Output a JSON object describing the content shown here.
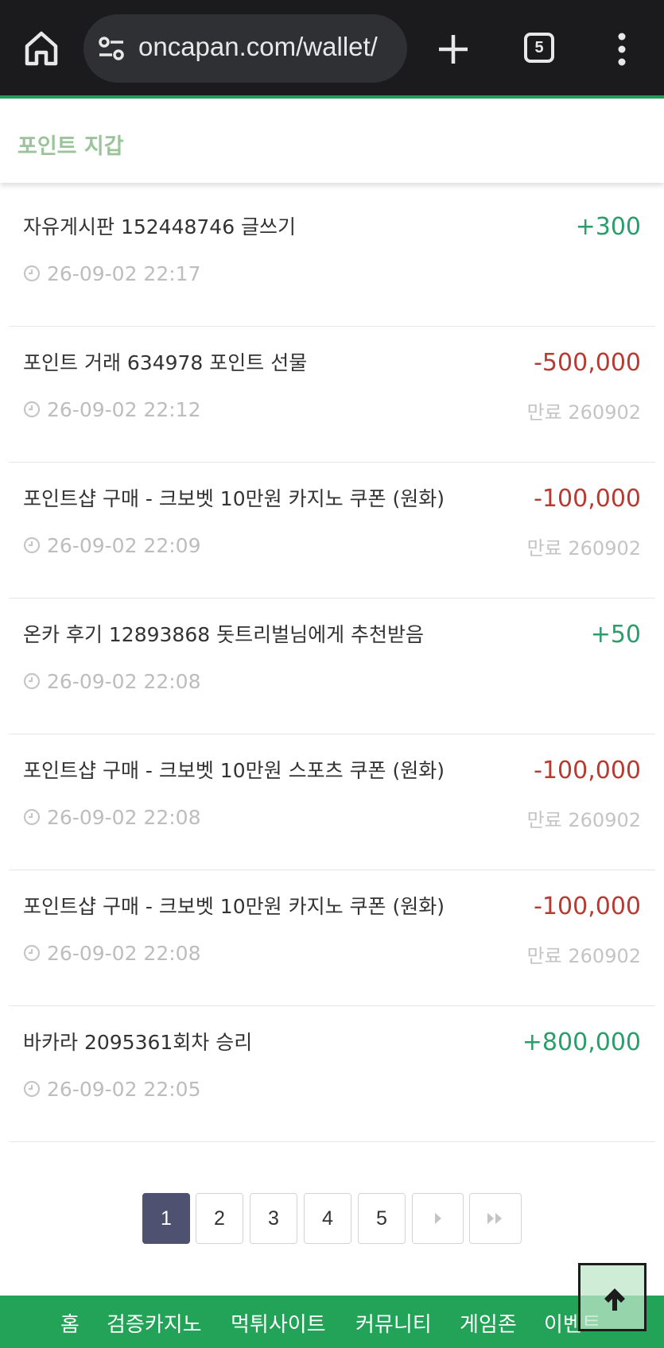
{
  "browser": {
    "url": "oncapan.com/wallet/",
    "tab_count": "5"
  },
  "header": {
    "title": "포인트 지갑"
  },
  "transactions": [
    {
      "desc": "자유게시판 152448746 글쓰기",
      "time": "26-09-02 22:17",
      "amount": "+300",
      "expire": ""
    },
    {
      "desc": "포인트 거래 634978 포인트 선물",
      "time": "26-09-02 22:12",
      "amount": "-500,000",
      "expire": "만료 260902"
    },
    {
      "desc": "포인트샵 구매 - 크보벳 10만원 카지노 쿠폰 (원화)",
      "time": "26-09-02 22:09",
      "amount": "-100,000",
      "expire": "만료 260902"
    },
    {
      "desc": "온카 후기 12893868 돗트리벌님에게 추천받음",
      "time": "26-09-02 22:08",
      "amount": "+50",
      "expire": ""
    },
    {
      "desc": "포인트샵 구매 - 크보벳 10만원 스포츠 쿠폰 (원화)",
      "time": "26-09-02 22:08",
      "amount": "-100,000",
      "expire": "만료 260902"
    },
    {
      "desc": "포인트샵 구매 - 크보벳 10만원 카지노 쿠폰 (원화)",
      "time": "26-09-02 22:08",
      "amount": "-100,000",
      "expire": "만료 260902"
    },
    {
      "desc": "바카라 2095361회차 승리",
      "time": "26-09-02 22:05",
      "amount": "+800,000",
      "expire": ""
    }
  ],
  "pagination": {
    "pages": [
      "1",
      "2",
      "3",
      "4",
      "5"
    ],
    "active": "1"
  },
  "footer_nav": {
    "items": [
      "홈",
      "검증카지노",
      "먹튀사이트",
      "커뮤니티",
      "게임존",
      "이벤트"
    ]
  },
  "colors": {
    "positive": "#2a9d6a",
    "negative": "#b63b32",
    "accent": "#22a358",
    "active_page": "#4e5270"
  },
  "icons": [
    "home-icon",
    "site-settings-icon",
    "plus-icon",
    "tabs-icon",
    "more-vert-icon",
    "clock-icon",
    "next-page-icon",
    "last-page-icon",
    "arrow-up-icon"
  ]
}
